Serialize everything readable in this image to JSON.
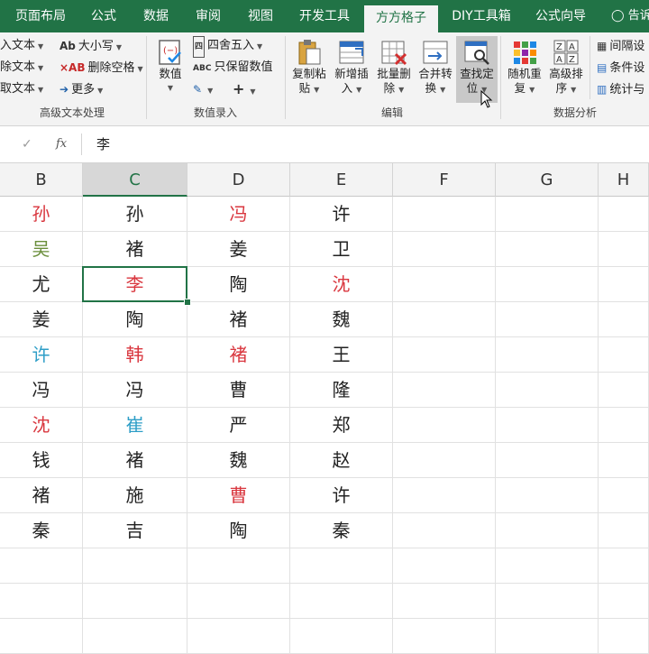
{
  "tabs": [
    {
      "label": "页面布局",
      "active": false
    },
    {
      "label": "公式",
      "active": false
    },
    {
      "label": "数据",
      "active": false
    },
    {
      "label": "审阅",
      "active": false
    },
    {
      "label": "视图",
      "active": false
    },
    {
      "label": "开发工具",
      "active": false
    },
    {
      "label": "方方格子",
      "active": true
    },
    {
      "label": "DIY工具箱",
      "active": false
    },
    {
      "label": "公式向导",
      "active": false
    }
  ],
  "tell_me": "告诉",
  "ribbon": {
    "text_group": {
      "label": "高级文本处理",
      "items": [
        "入文本",
        "除文本",
        "取文本"
      ],
      "case_label": "大小写",
      "remove_space_label": "删除空格",
      "more_label": "更多"
    },
    "numeric_group": {
      "label": "数值录入",
      "numeric_label": "数值",
      "round_label": "四舍五入",
      "keep_values_label": "只保留数值"
    },
    "edit_group": {
      "label": "编辑",
      "buttons": [
        {
          "line1": "复制粘",
          "line2": "贴"
        },
        {
          "line1": "新增插",
          "line2": "入"
        },
        {
          "line1": "批量删",
          "line2": "除"
        },
        {
          "line1": "合并转",
          "line2": "换"
        },
        {
          "line1": "查找定",
          "line2": "位"
        }
      ]
    },
    "analysis_group": {
      "label": "数据分析",
      "random_line1": "随机重",
      "random_line2": "复",
      "sort_line1": "高级排",
      "sort_line2": "序",
      "right_items": [
        "间隔设",
        "条件设",
        "统计与"
      ]
    }
  },
  "formula_bar": {
    "fx": "fx",
    "value": "李"
  },
  "columns": [
    "B",
    "C",
    "D",
    "E",
    "F",
    "G",
    "H"
  ],
  "selected_column": "C",
  "colors": {
    "accent": "#217346",
    "red": "#d9363e",
    "green": "#6a8e3a",
    "blue": "#2e9ec7",
    "black": "#222222"
  },
  "grid_rows": [
    [
      {
        "t": "孙",
        "c": "red"
      },
      {
        "t": "孙",
        "c": "black"
      },
      {
        "t": "冯",
        "c": "red"
      },
      {
        "t": "许",
        "c": "black"
      }
    ],
    [
      {
        "t": "吴",
        "c": "green"
      },
      {
        "t": "褚",
        "c": "black"
      },
      {
        "t": "姜",
        "c": "black"
      },
      {
        "t": "卫",
        "c": "black"
      }
    ],
    [
      {
        "t": "尤",
        "c": "black"
      },
      {
        "t": "李",
        "c": "red"
      },
      {
        "t": "陶",
        "c": "black"
      },
      {
        "t": "沈",
        "c": "red"
      }
    ],
    [
      {
        "t": "姜",
        "c": "black"
      },
      {
        "t": "陶",
        "c": "black"
      },
      {
        "t": "褚",
        "c": "black"
      },
      {
        "t": "魏",
        "c": "black"
      }
    ],
    [
      {
        "t": "许",
        "c": "blue"
      },
      {
        "t": "韩",
        "c": "red"
      },
      {
        "t": "褚",
        "c": "red"
      },
      {
        "t": "王",
        "c": "black"
      }
    ],
    [
      {
        "t": "冯",
        "c": "black"
      },
      {
        "t": "冯",
        "c": "black"
      },
      {
        "t": "曹",
        "c": "black"
      },
      {
        "t": "隆",
        "c": "black"
      }
    ],
    [
      {
        "t": "沈",
        "c": "red"
      },
      {
        "t": "崔",
        "c": "blue"
      },
      {
        "t": "严",
        "c": "black"
      },
      {
        "t": "郑",
        "c": "black"
      }
    ],
    [
      {
        "t": "钱",
        "c": "black"
      },
      {
        "t": "褚",
        "c": "black"
      },
      {
        "t": "魏",
        "c": "black"
      },
      {
        "t": "赵",
        "c": "black"
      }
    ],
    [
      {
        "t": "褚",
        "c": "black"
      },
      {
        "t": "施",
        "c": "black"
      },
      {
        "t": "曹",
        "c": "red"
      },
      {
        "t": "许",
        "c": "black"
      }
    ],
    [
      {
        "t": "秦",
        "c": "black"
      },
      {
        "t": "吉",
        "c": "black"
      },
      {
        "t": "陶",
        "c": "black"
      },
      {
        "t": "秦",
        "c": "black"
      }
    ],
    [
      {
        "t": "",
        "c": "black"
      },
      {
        "t": "",
        "c": "black"
      },
      {
        "t": "",
        "c": "black"
      },
      {
        "t": "",
        "c": "black"
      }
    ],
    [
      {
        "t": "",
        "c": "black"
      },
      {
        "t": "",
        "c": "black"
      },
      {
        "t": "",
        "c": "black"
      },
      {
        "t": "",
        "c": "black"
      }
    ],
    [
      {
        "t": "",
        "c": "black"
      },
      {
        "t": "",
        "c": "black"
      },
      {
        "t": "",
        "c": "black"
      },
      {
        "t": "",
        "c": "black"
      }
    ]
  ],
  "active_cell": {
    "row": 3,
    "col": "C"
  }
}
